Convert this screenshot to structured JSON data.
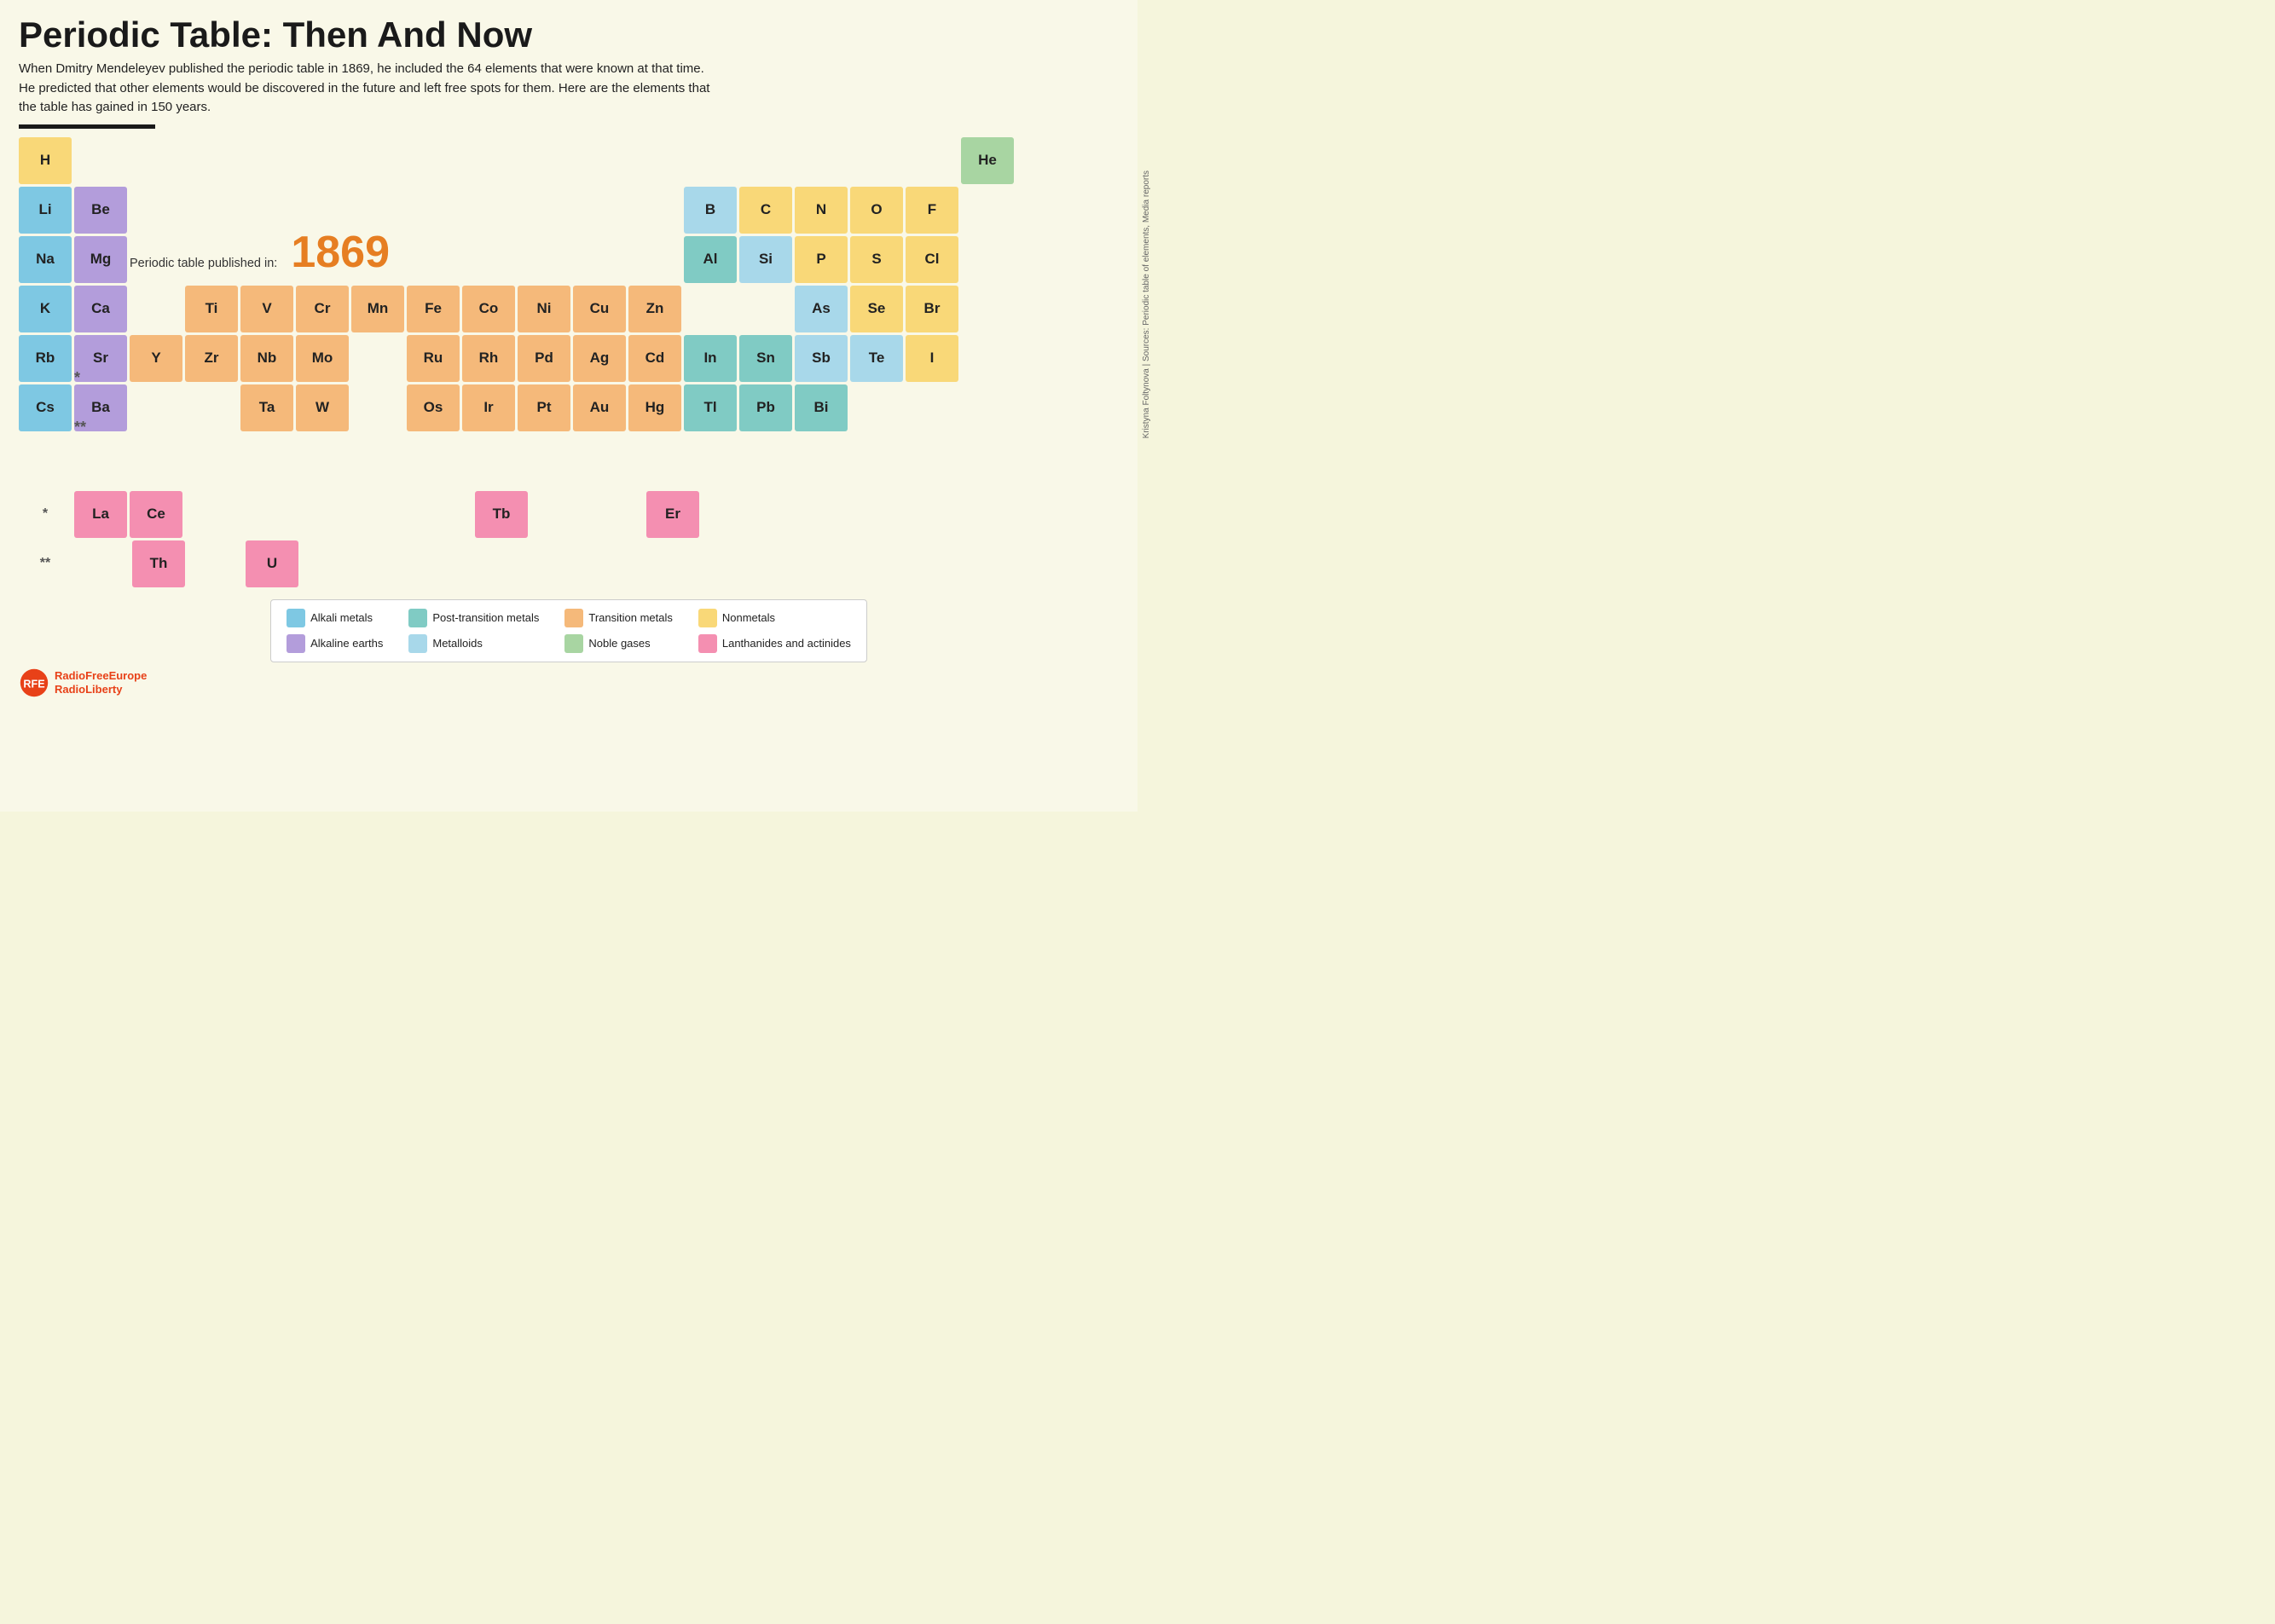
{
  "title": "Periodic Table: Then And Now",
  "subtitle": "When Dmitry Mendeleyev published the periodic table in 1869, he included the 64 elements that were known at that time. He predicted that other elements would be discovered in the future and left free spots for them. Here are the elements that the table has gained in 150 years.",
  "year_label": "Periodic table published in:",
  "year": "1869",
  "source": "Kristyna Foltynova | Sources: Periodic table of elements, Media reports",
  "logo_line1": "RadioFreeEurope",
  "logo_line2": "RadioLiberty",
  "legend": [
    {
      "label": "Alkali metals",
      "color": "#7ec8e3"
    },
    {
      "label": "Post-transition metals",
      "color": "#80cbc4"
    },
    {
      "label": "Transition metals",
      "color": "#f5b97a"
    },
    {
      "label": "Nonmetals",
      "color": "#f9d878"
    },
    {
      "label": "Alkaline earths",
      "color": "#b39ddb"
    },
    {
      "label": "Metalloids",
      "color": "#a8d8ea"
    },
    {
      "label": "Noble gases",
      "color": "#a8d5a2"
    },
    {
      "label": "Lanthanides and actinides",
      "color": "#f48fb1"
    }
  ],
  "elements": {
    "H": {
      "symbol": "H",
      "type": "nonmetal",
      "col": 1,
      "row": 1
    },
    "He": {
      "symbol": "He",
      "type": "noble",
      "col": 18,
      "row": 1
    },
    "Li": {
      "symbol": "Li",
      "type": "alkali",
      "col": 1,
      "row": 2
    },
    "Be": {
      "symbol": "Be",
      "type": "alkaline",
      "col": 2,
      "row": 2
    },
    "B": {
      "symbol": "B",
      "type": "metalloid",
      "col": 13,
      "row": 2
    },
    "C": {
      "symbol": "C",
      "type": "nonmetal",
      "col": 14,
      "row": 2
    },
    "N": {
      "symbol": "N",
      "type": "nonmetal",
      "col": 15,
      "row": 2
    },
    "O": {
      "symbol": "O",
      "type": "nonmetal",
      "col": 16,
      "row": 2
    },
    "F": {
      "symbol": "F",
      "type": "nonmetal",
      "col": 17,
      "row": 2
    },
    "Na": {
      "symbol": "Na",
      "type": "alkali",
      "col": 1,
      "row": 3
    },
    "Mg": {
      "symbol": "Mg",
      "type": "alkaline",
      "col": 2,
      "row": 3
    },
    "Al": {
      "symbol": "Al",
      "type": "post-transition",
      "col": 13,
      "row": 3
    },
    "Si": {
      "symbol": "Si",
      "type": "metalloid",
      "col": 14,
      "row": 3
    },
    "P": {
      "symbol": "P",
      "type": "nonmetal",
      "col": 15,
      "row": 3
    },
    "S": {
      "symbol": "S",
      "type": "nonmetal",
      "col": 16,
      "row": 3
    },
    "Cl": {
      "symbol": "Cl",
      "type": "nonmetal",
      "col": 17,
      "row": 3
    },
    "K": {
      "symbol": "K",
      "type": "alkali",
      "col": 1,
      "row": 4
    },
    "Ca": {
      "symbol": "Ca",
      "type": "alkaline",
      "col": 2,
      "row": 4
    },
    "Ti": {
      "symbol": "Ti",
      "type": "transition",
      "col": 4,
      "row": 4
    },
    "V": {
      "symbol": "V",
      "type": "transition",
      "col": 5,
      "row": 4
    },
    "Cr": {
      "symbol": "Cr",
      "type": "transition",
      "col": 6,
      "row": 4
    },
    "Mn": {
      "symbol": "Mn",
      "type": "transition",
      "col": 7,
      "row": 4
    },
    "Fe": {
      "symbol": "Fe",
      "type": "transition",
      "col": 8,
      "row": 4
    },
    "Co": {
      "symbol": "Co",
      "type": "transition",
      "col": 9,
      "row": 4
    },
    "Ni": {
      "symbol": "Ni",
      "type": "transition",
      "col": 10,
      "row": 4
    },
    "Cu": {
      "symbol": "Cu",
      "type": "transition",
      "col": 11,
      "row": 4
    },
    "Zn": {
      "symbol": "Zn",
      "type": "transition",
      "col": 12,
      "row": 4
    },
    "As": {
      "symbol": "As",
      "type": "metalloid",
      "col": 15,
      "row": 4
    },
    "Se": {
      "symbol": "Se",
      "type": "nonmetal",
      "col": 16,
      "row": 4
    },
    "Br": {
      "symbol": "Br",
      "type": "nonmetal",
      "col": 17,
      "row": 4
    },
    "Rb": {
      "symbol": "Rb",
      "type": "alkali",
      "col": 1,
      "row": 5
    },
    "Sr": {
      "symbol": "Sr",
      "type": "alkaline",
      "col": 2,
      "row": 5
    },
    "Y": {
      "symbol": "Y",
      "type": "transition",
      "col": 3,
      "row": 5
    },
    "Zr": {
      "symbol": "Zr",
      "type": "transition",
      "col": 4,
      "row": 5
    },
    "Nb": {
      "symbol": "Nb",
      "type": "transition",
      "col": 5,
      "row": 5
    },
    "Mo": {
      "symbol": "Mo",
      "type": "transition",
      "col": 6,
      "row": 5
    },
    "Ru": {
      "symbol": "Ru",
      "type": "transition",
      "col": 8,
      "row": 5
    },
    "Rh": {
      "symbol": "Rh",
      "type": "transition",
      "col": 9,
      "row": 5
    },
    "Pd": {
      "symbol": "Pd",
      "type": "transition",
      "col": 10,
      "row": 5
    },
    "Ag": {
      "symbol": "Ag",
      "type": "transition",
      "col": 11,
      "row": 5
    },
    "Cd": {
      "symbol": "Cd",
      "type": "transition",
      "col": 12,
      "row": 5
    },
    "In": {
      "symbol": "In",
      "type": "post-transition",
      "col": 13,
      "row": 5
    },
    "Sn": {
      "symbol": "Sn",
      "type": "post-transition",
      "col": 14,
      "row": 5
    },
    "Sb": {
      "symbol": "Sb",
      "type": "metalloid",
      "col": 15,
      "row": 5
    },
    "Te": {
      "symbol": "Te",
      "type": "metalloid",
      "col": 16,
      "row": 5
    },
    "I": {
      "symbol": "I",
      "type": "nonmetal",
      "col": 17,
      "row": 5
    },
    "Cs": {
      "symbol": "Cs",
      "type": "alkali",
      "col": 1,
      "row": 6
    },
    "Ba": {
      "symbol": "Ba",
      "type": "alkaline",
      "col": 2,
      "row": 6
    },
    "Ta": {
      "symbol": "Ta",
      "type": "transition",
      "col": 5,
      "row": 6
    },
    "W": {
      "symbol": "W",
      "type": "transition",
      "col": 6,
      "row": 6
    },
    "Os": {
      "symbol": "Os",
      "type": "transition",
      "col": 8,
      "row": 6
    },
    "Ir": {
      "symbol": "Ir",
      "type": "transition",
      "col": 9,
      "row": 6
    },
    "Pt": {
      "symbol": "Pt",
      "type": "transition",
      "col": 10,
      "row": 6
    },
    "Au": {
      "symbol": "Au",
      "type": "transition",
      "col": 11,
      "row": 6
    },
    "Hg": {
      "symbol": "Hg",
      "type": "transition",
      "col": 12,
      "row": 6
    },
    "Tl": {
      "symbol": "Tl",
      "type": "post-transition",
      "col": 13,
      "row": 6
    },
    "Pb": {
      "symbol": "Pb",
      "type": "post-transition",
      "col": 14,
      "row": 6
    },
    "Bi": {
      "symbol": "Bi",
      "type": "post-transition",
      "col": 15,
      "row": 6
    }
  }
}
